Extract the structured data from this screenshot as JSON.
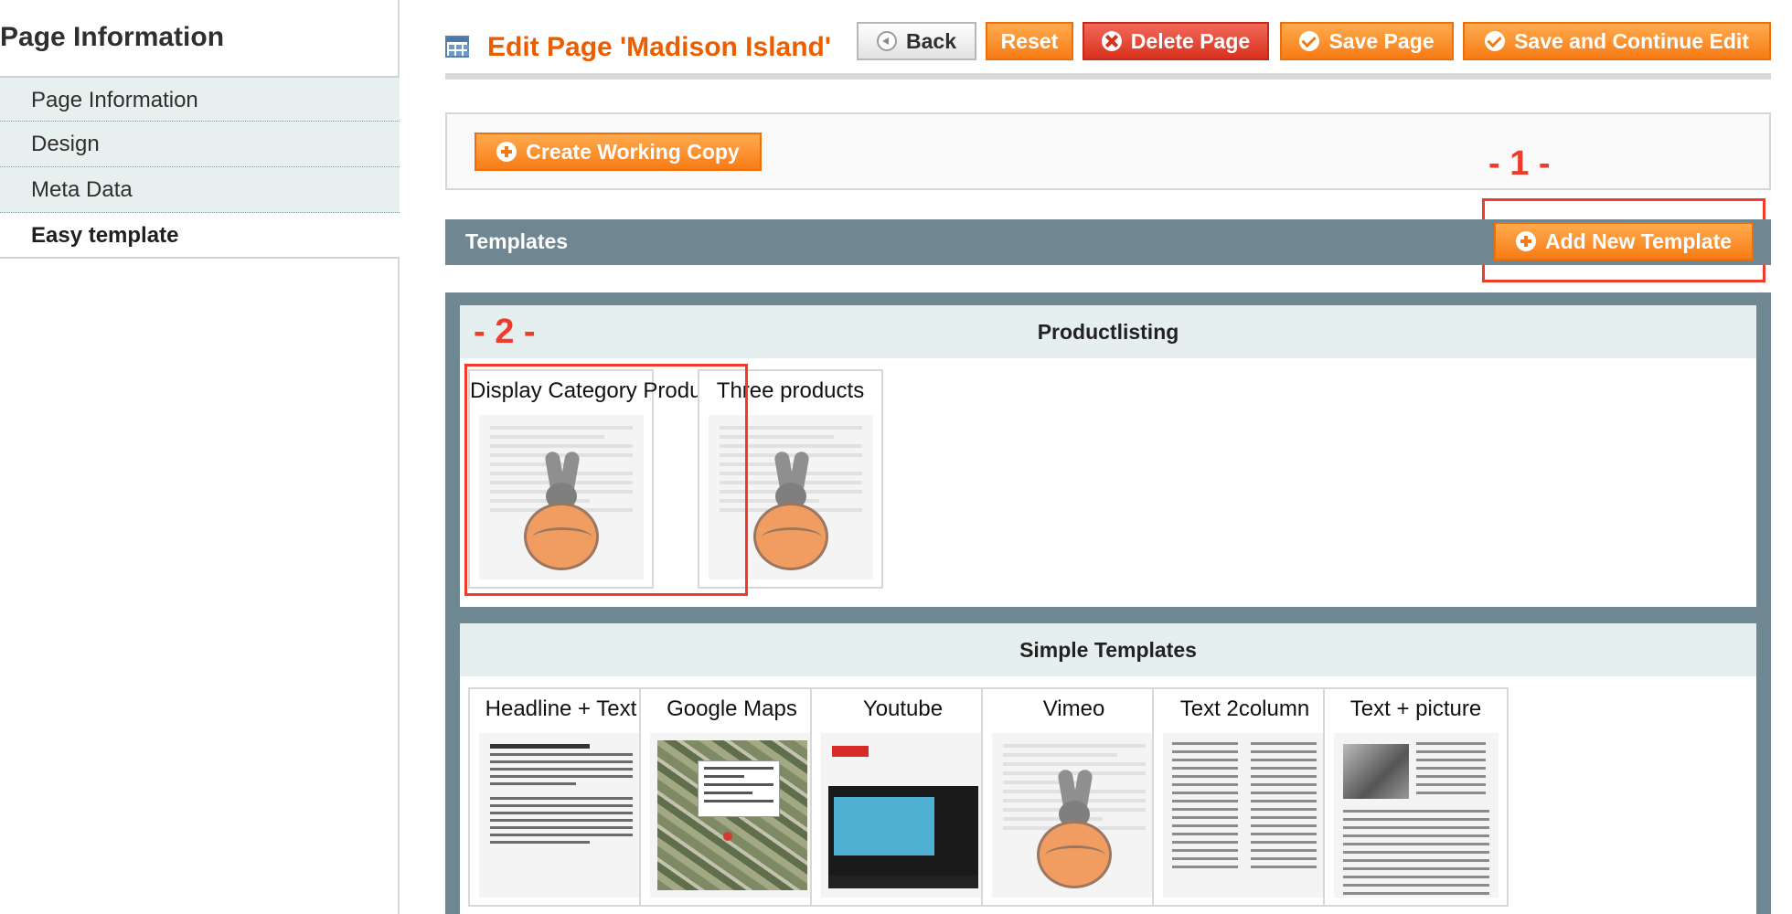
{
  "sidebar": {
    "title": "Page Information",
    "tabs": [
      {
        "label": "Page Information",
        "active": false
      },
      {
        "label": "Design",
        "active": false
      },
      {
        "label": "Meta Data",
        "active": false
      },
      {
        "label": "Easy template",
        "active": true
      }
    ]
  },
  "header": {
    "title": "Edit Page 'Madison Island'",
    "buttons": {
      "back": "Back",
      "reset": "Reset",
      "delete": "Delete Page",
      "save": "Save Page",
      "save_continue": "Save and Continue Edit"
    }
  },
  "working_copy": {
    "button": "Create Working Copy"
  },
  "annotations": {
    "one": "- 1 -",
    "two": "- 2 -",
    "color": "#f03a2a"
  },
  "templates": {
    "title": "Templates",
    "add_button": "Add New Template",
    "groups": [
      {
        "title": "Productlisting",
        "cards": [
          {
            "title": "Display Category Products",
            "icon": "mascot-placeholder-thumbnail"
          },
          {
            "title": "Three products",
            "icon": "mascot-placeholder-thumbnail"
          }
        ]
      },
      {
        "title": "Simple Templates",
        "cards": [
          {
            "title": "Headline + Text",
            "icon": "text-article-thumbnail"
          },
          {
            "title": "Google Maps",
            "icon": "map-thumbnail"
          },
          {
            "title": "Youtube",
            "icon": "video-thumbnail"
          },
          {
            "title": "Vimeo",
            "icon": "mascot-placeholder-thumbnail"
          },
          {
            "title": "Text 2column",
            "icon": "two-column-text-thumbnail"
          },
          {
            "title": "Text + picture",
            "icon": "text-picture-thumbnail"
          }
        ]
      }
    ]
  },
  "colors": {
    "accent": "#eb5e00",
    "button_orange": "#f77c16",
    "button_red": "#d9311d",
    "bar": "#6e8791",
    "tab_bg": "#e7efef"
  }
}
